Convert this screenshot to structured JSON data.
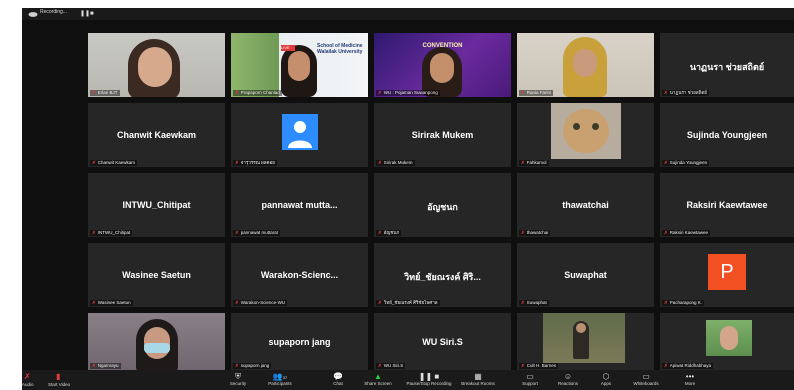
{
  "recording": {
    "label": "Recording...",
    "pause_icon": "pause-icon",
    "stop_icon": "stop-icon"
  },
  "tiles": [
    {
      "id": "t1",
      "label": "Erlan BJT",
      "video": true,
      "overlay_text": ""
    },
    {
      "id": "t2",
      "label": "Prapaporn Chanlad",
      "video": true,
      "overlay_text": "School of Medicine Walailak University"
    },
    {
      "id": "t3",
      "label": "WU : Pojaman Suwanpong",
      "video": true,
      "overlay_text": "CONVENTION"
    },
    {
      "id": "t4",
      "label": "Rania Farim",
      "video": true,
      "overlay_text": ""
    },
    {
      "id": "t5",
      "name": "นาฏนรา ช่วยสถิตย์",
      "label": "นาฏนรา ช่วยสถิตย์",
      "video": false
    },
    {
      "id": "t6",
      "name": "Chanwit Kaewkam",
      "label": "Chanwit Kaewkam",
      "video": false
    },
    {
      "id": "t7",
      "label": "จารุวรรณ ผลคอย",
      "video": false,
      "avatar": true
    },
    {
      "id": "t8",
      "name": "Sirirak Mukem",
      "label": "Sirirak Mukem",
      "video": false
    },
    {
      "id": "t9",
      "label": "Fahkamol",
      "video": true,
      "overlay_text": ""
    },
    {
      "id": "t10",
      "name": "Sujinda Youngjeen",
      "label": "Sujinda Youngjeen",
      "video": false
    },
    {
      "id": "t11",
      "name": "INTWU_Chitipat",
      "label": "INTWU_Chitipat",
      "video": false
    },
    {
      "id": "t12",
      "name": "pannawat mutta...",
      "label": "pannawat muttarat",
      "video": false
    },
    {
      "id": "t13",
      "name": "อัญชนก",
      "label": "อัญชนก",
      "video": false
    },
    {
      "id": "t14",
      "name": "thawatchai",
      "label": "thawatchai",
      "video": false
    },
    {
      "id": "t15",
      "name": "Raksiri Kaewtawee",
      "label": "Raksiri Kaewtawee",
      "video": false
    },
    {
      "id": "t16",
      "name": "Wasinee Saetun",
      "label": "Wasinee Saetun",
      "video": false
    },
    {
      "id": "t17",
      "name": "Warakon-Scienc...",
      "label": "Warakon-Science-WU",
      "video": false
    },
    {
      "id": "t18",
      "name": "วิทย์_ชัยณรงค์ ศิริ...",
      "label": "วิทย์_ชัยณรงค์ ศิริชัยไพศาล",
      "video": false
    },
    {
      "id": "t19",
      "name": "Suwaphat",
      "label": "Suwaphat",
      "video": false
    },
    {
      "id": "t20",
      "label": "Pacharapong K.",
      "video": false,
      "initial": "P"
    },
    {
      "id": "t21",
      "label": "Ngamrayu",
      "video": true,
      "overlay_text": ""
    },
    {
      "id": "t22",
      "name": "supaporn jang",
      "label": "supaporn jang",
      "video": false
    },
    {
      "id": "t23",
      "name": "WU Siri.S",
      "label": "WU Siri.S",
      "video": false
    },
    {
      "id": "t24",
      "label": "Cult H. Barnes",
      "video": true,
      "overlay_text": ""
    },
    {
      "id": "t25",
      "label": "Apiwat Riddhabhaya",
      "video": true,
      "overlay_text": ""
    }
  ],
  "toolbar": {
    "left": [
      {
        "label": "Audio",
        "icon": "mic-muted-icon"
      },
      {
        "label": "Start Video",
        "icon": "video-off-icon"
      }
    ],
    "center": [
      {
        "label": "Security",
        "icon": "shield-icon"
      },
      {
        "label": "Participants",
        "icon": "participants-icon",
        "count": "37"
      },
      {
        "label": "Chat",
        "icon": "chat-icon"
      },
      {
        "label": "Share Screen",
        "icon": "share-screen-icon"
      },
      {
        "label": "Pause/Stop Recording",
        "icon": "recording-icon"
      },
      {
        "label": "Breakout Rooms",
        "icon": "breakout-rooms-icon"
      },
      {
        "label": "Support",
        "icon": "support-icon"
      },
      {
        "label": "Reactions",
        "icon": "reactions-icon"
      },
      {
        "label": "Apps",
        "icon": "apps-icon"
      },
      {
        "label": "Whiteboards",
        "icon": "whiteboard-icon"
      },
      {
        "label": "More",
        "icon": "more-icon"
      }
    ]
  },
  "colors": {
    "mute": "#e23b3b",
    "share": "#2ecc40",
    "avatar": "#2d8cff",
    "initial_tile": "#f25022"
  }
}
